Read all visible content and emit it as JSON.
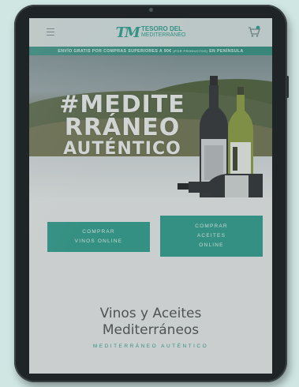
{
  "header": {
    "logo_mark": "TM",
    "logo_line1": "TESORO DEL",
    "logo_line2": "MEDITERRÁNEO",
    "menu_icon": "hamburger-icon",
    "cart_icon": "cart-icon"
  },
  "promo": {
    "text_main": "ENVÍO GRATIS POR COMPRAS SUPERIORES A 90€",
    "text_small": "(POR PRODUCTOS)",
    "text_end": "EN PENÍNSULA"
  },
  "hero": {
    "line1": "#MEDITE",
    "line2": "RRÁNEO",
    "line3": "AUTÉNTICO"
  },
  "cta": {
    "wines_line1": "COMPRAR",
    "wines_line2": "VINOS ONLINE",
    "oils_line1": "COMPRAR",
    "oils_line2": "ACEITES",
    "oils_line3": "ONLINE"
  },
  "section": {
    "heading_line1": "Vinos y Aceites",
    "heading_line2": "Mediterráneos",
    "subheading": "MEDITERRÁNEO AUTÉNTICO"
  },
  "colors": {
    "accent": "#2a9a87",
    "promo_bar": "#2f8c7c",
    "tablet_bezel": "#1f2526",
    "background": "#cfe6e3"
  }
}
